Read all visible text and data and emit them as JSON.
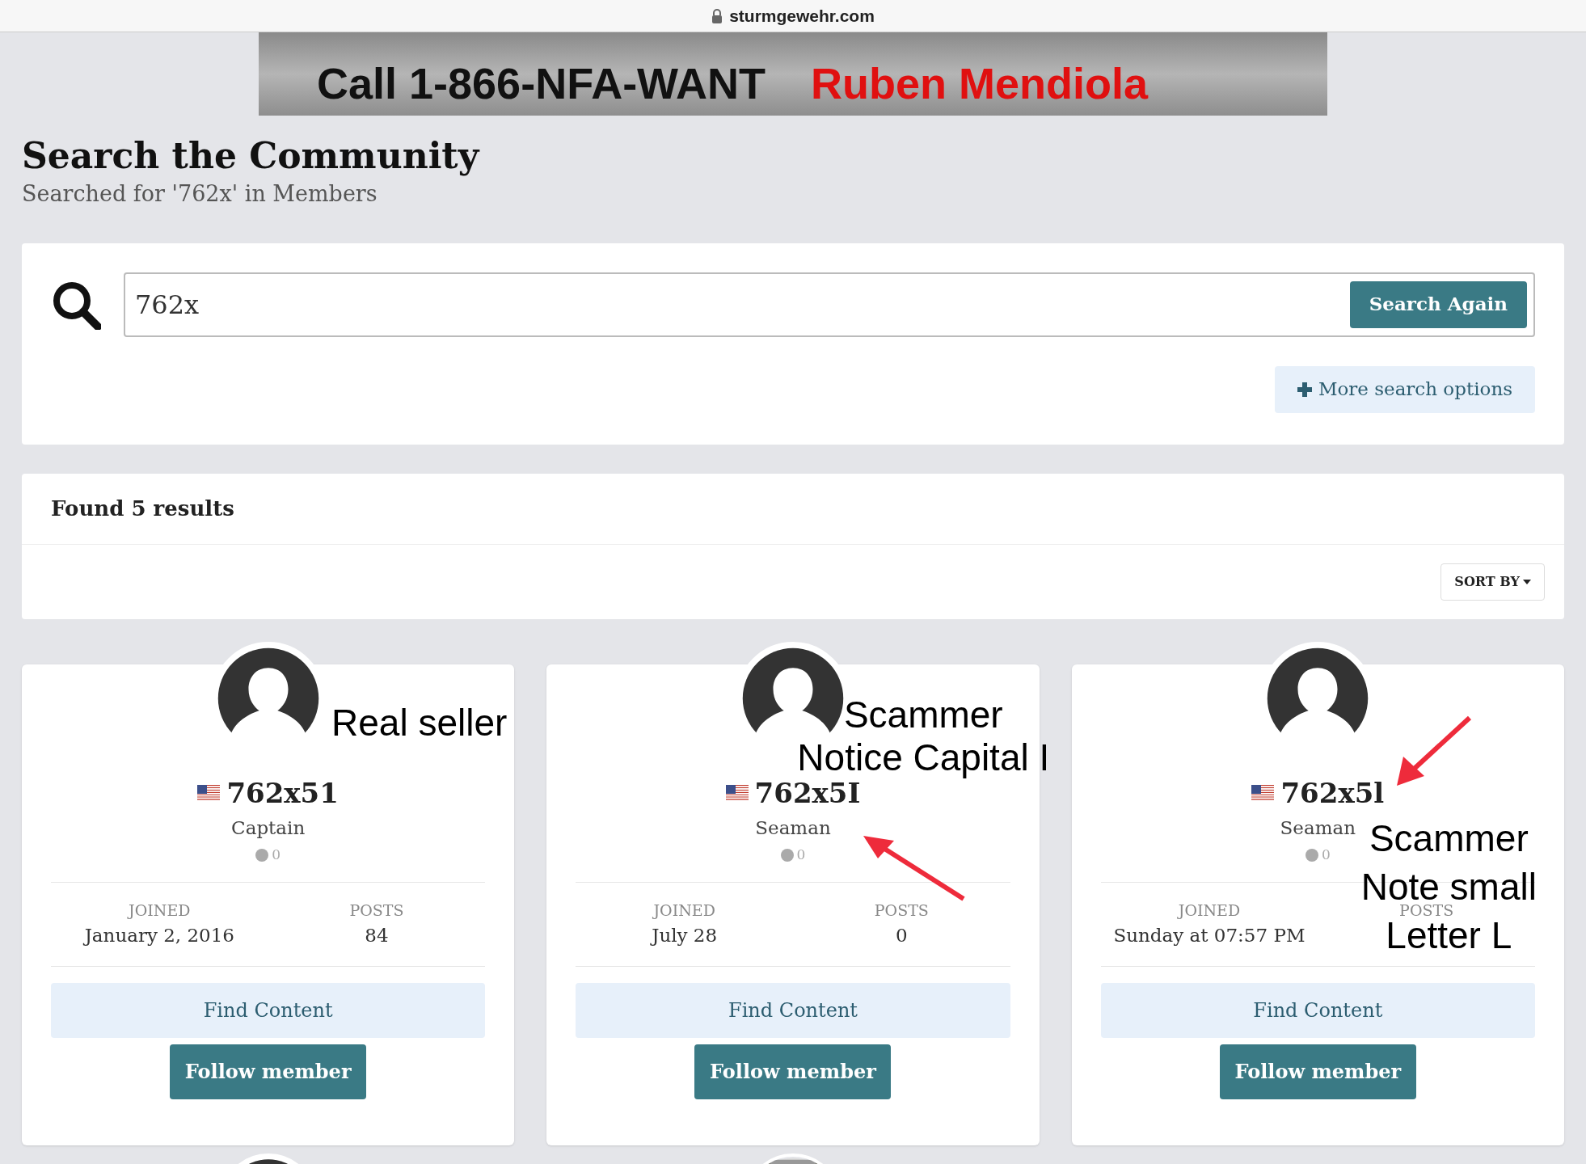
{
  "browser": {
    "url": "sturmgewehr.com"
  },
  "banner": {
    "phone": "Call 1-866-NFA-WANT",
    "name": "Ruben Mendiola"
  },
  "header": {
    "title": "Search the Community",
    "subtitle": "Searched for '762x' in Members"
  },
  "search": {
    "value": "762x",
    "button": "Search Again",
    "more_options": "More search options"
  },
  "results": {
    "heading": "Found 5 results",
    "sort": "SORT BY"
  },
  "cards": [
    {
      "username": "762x51",
      "rank": "Captain",
      "reputation": "0",
      "joined_label": "JOINED",
      "joined": "January 2, 2016",
      "posts_label": "POSTS",
      "posts": "84",
      "find": "Find Content",
      "follow": "Follow member",
      "annotation": {
        "kind": "plain",
        "lines": [
          "Real seller"
        ]
      }
    },
    {
      "username": "762x5I",
      "rank": "Seaman",
      "reputation": "0",
      "joined_label": "JOINED",
      "joined": "July 28",
      "posts_label": "POSTS",
      "posts": "0",
      "find": "Find Content",
      "follow": "Follow member",
      "annotation": {
        "kind": "arrowbelow",
        "lines": [
          "Scammer",
          "Notice Capital I"
        ]
      }
    },
    {
      "username": "762x5l",
      "rank": "Seaman",
      "reputation": "0",
      "joined_label": "JOINED",
      "joined": "Sunday at 07:57 PM",
      "posts_label": "POSTS",
      "find": "Find Content",
      "follow": "Follow member",
      "annotation": {
        "kind": "arrowabove",
        "lines": [
          "Scammer",
          "Note small",
          "Letter L"
        ]
      }
    }
  ],
  "next_row": [
    {
      "kind": "avatar"
    },
    {
      "kind": "picture"
    }
  ]
}
